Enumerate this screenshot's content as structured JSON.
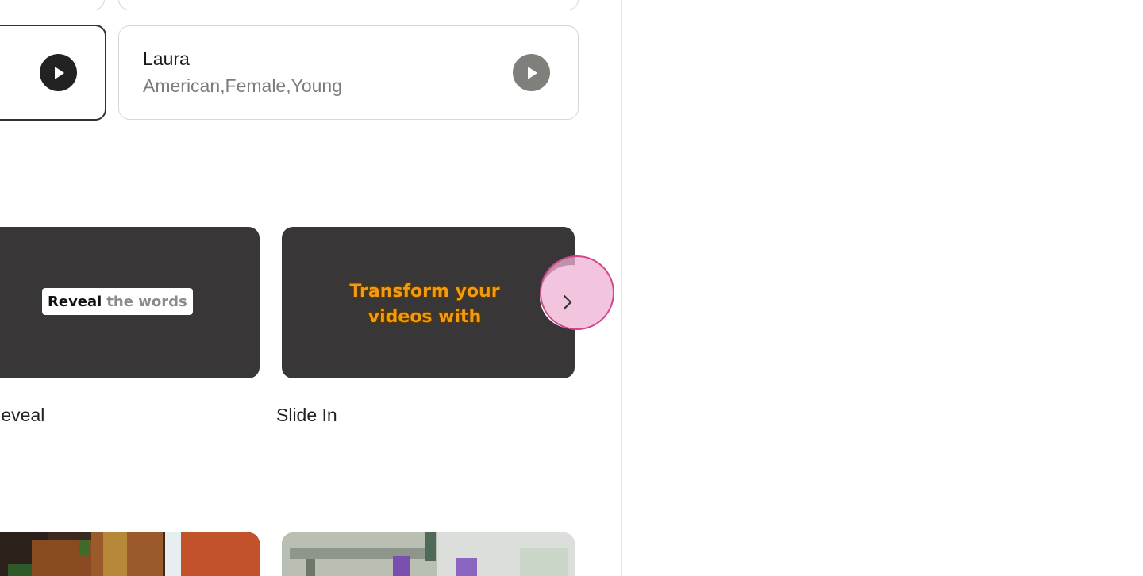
{
  "voices": {
    "laura": {
      "name": "Laura",
      "tags": "American,Female,Young"
    }
  },
  "animations": {
    "reveal": {
      "label": "t Reveal",
      "preview_strong": "Reveal",
      "preview_muted": "the words"
    },
    "slide": {
      "label": "Slide In",
      "preview_text": "Transform your videos with"
    }
  },
  "icons": {
    "play": "play-icon",
    "next": "chevron-right-icon"
  },
  "colors": {
    "selected_border": "#333333",
    "play_dark": "#222222",
    "play_grey": "#7f7f7b",
    "thumb_bg": "#383637",
    "slide_text": "#f29a13",
    "next_ring": "#d2458b",
    "next_fill": "#eeb0d2"
  }
}
